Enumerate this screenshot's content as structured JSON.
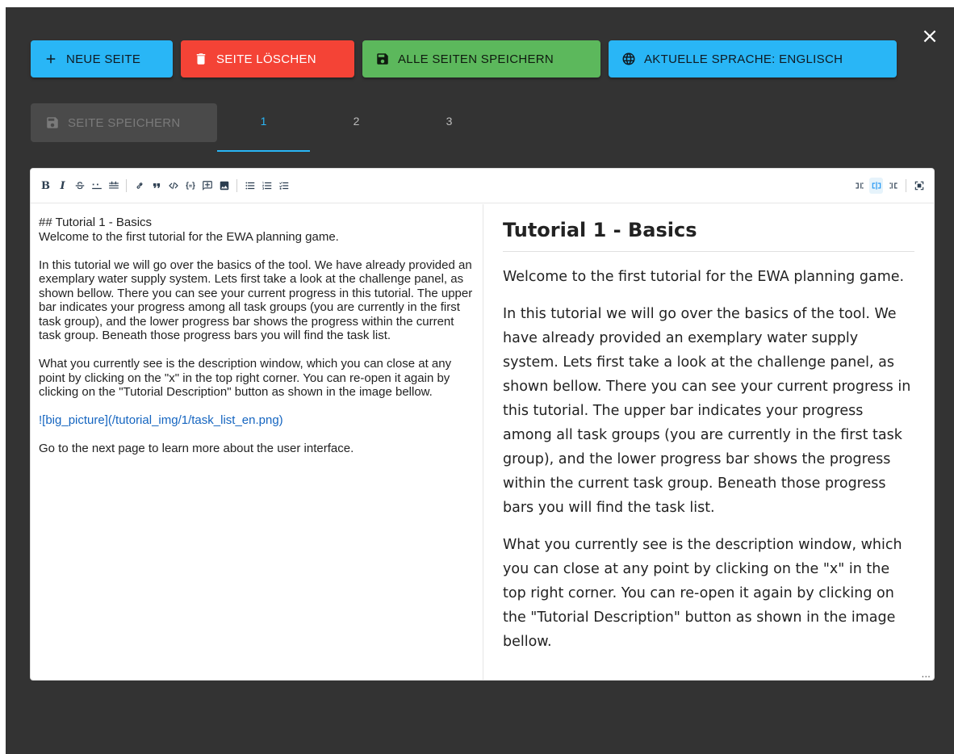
{
  "close_icon": "×",
  "actions": {
    "new_page": "NEUE SEITE",
    "delete_page": "SEITE LÖSCHEN",
    "save_all": "ALLE SEITEN SPEICHERN",
    "language": "AKTUELLE SPRACHE: ENGLISCH"
  },
  "tabs": {
    "save_page": "SEITE SPEICHERN",
    "items": [
      "1",
      "2",
      "3"
    ],
    "active_index": 0
  },
  "toolbar": {
    "bold": "B",
    "italic": "I"
  },
  "source": {
    "heading_line": "## Tutorial 1 - Basics",
    "welcome_line": "Welcome to the first tutorial for the EWA planning game.",
    "para1": "In this tutorial we will go over the basics of the tool. We have already provided an exemplary water supply system. Lets first take a look at the challenge panel, as shown bellow. There you can see your current progress in this tutorial. The upper bar indicates your progress among all task groups (you are currently in the first task group), and the lower progress bar shows the progress within the current task group. Beneath those progress bars you will find the task list.",
    "para2": "What you currently see is the description window, which you can close at any point by clicking on the \"x\" in the top right corner. You can re-open it again by clicking on the \"Tutorial Description\" button as shown in the image bellow.",
    "image_link": "![big_picture](/tutorial_img/1/task_list_en.png)",
    "para3": "Go to the next page to learn more about the user interface."
  },
  "preview": {
    "title": "Tutorial 1 - Basics",
    "p1": "Welcome to the first tutorial for the EWA planning game.",
    "p2": "In this tutorial we will go over the basics of the tool. We have already provided an exemplary water supply system. Lets first take a look at the challenge panel, as shown bellow. There you can see your current progress in this tutorial. The upper bar indicates your progress among all task groups (you are currently in the first task group), and the lower progress bar shows the progress within the current task group. Beneath those progress bars you will find the task list.",
    "p3": "What you currently see is the description window, which you can close at any point by clicking on the \"x\" in the top right corner. You can re-open it again by clicking on the \"Tutorial Description\" button as shown in the image bellow.",
    "more": "..."
  },
  "colors": {
    "blue": "#29b6f6",
    "red": "#f44336",
    "green": "#5cb85c",
    "dialog_bg": "#333333"
  }
}
